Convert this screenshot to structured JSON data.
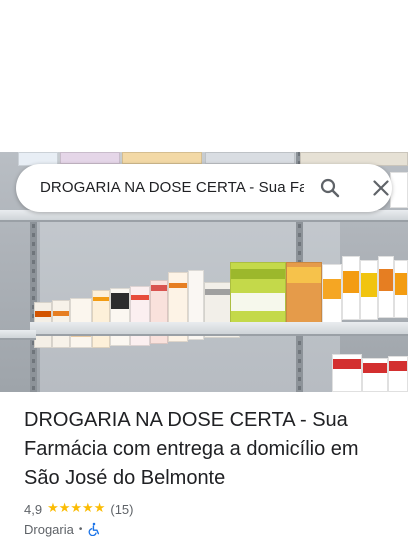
{
  "search": {
    "query": "DROGARIA NA DOSE CERTA - Sua Fa"
  },
  "place": {
    "title": "DROGARIA NA DOSE CERTA - Sua Farmácia com entrega a domicílio em São José do Belmonte",
    "rating": "4,9",
    "stars": 5,
    "review_count": "(15)",
    "category": "Drogaria",
    "separator": "•"
  },
  "icons": {
    "search": "search-icon",
    "close": "close-icon",
    "wheelchair": "wheelchair-accessible-icon"
  },
  "colors": {
    "star": "#fbbc04",
    "icon_gray": "#5f6368",
    "accessibility_blue": "#1a73e8"
  }
}
